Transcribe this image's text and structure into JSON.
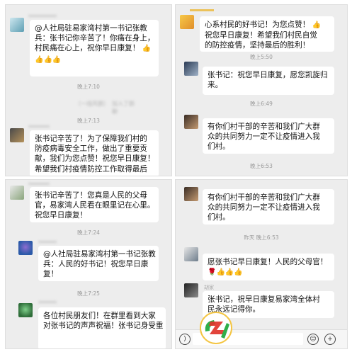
{
  "panel1": {
    "msg1": [
      "@人社局驻易家湾村第一书记张教",
      "兵：张书记你辛苦了！你痛在身上，",
      "村民痛在心上，祝你早日康复！"
    ],
    "time1": "晚上7:10",
    "ghost_text": "（一线风貌）",
    "ghost_join": "加入了群聊",
    "time2": "晚上7:13",
    "msg2": [
      "张书记辛苦了！为了保障我们村的",
      "防疫病毒安全工作，做出了重要贡",
      "献，我们为您点赞！祝您早日康复！",
      "希望我们村疫情防控工作取得最后"
    ]
  },
  "panel2": {
    "msg1": [
      "心系村民的好书记！为您点赞！",
      "祝您早日康复！希望我们村民自觉",
      "的防控疫情，坚持最后的胜利！"
    ],
    "time1": "晚上5:50",
    "msg2": [
      "张书记：祝您早日康复，愿您凯旋归",
      "来。"
    ],
    "time2": "晚上6:49",
    "msg3": [
      "有你们村干部的辛苦和我们广大群",
      "众的共同努力一定不让疫情进入我",
      "们村。"
    ],
    "time3": "晚上6:53"
  },
  "panel3": {
    "msg1": [
      "张书记辛苦了！您真是人民的父母",
      "官，易家湾人民看在眼里记在心里。",
      "祝您早日康复！"
    ],
    "time1": "晚上7:24",
    "msg2": [
      "@人社局驻易家湾村第一书记张教",
      "兵：人民的好书记！祝您早日康",
      "复！"
    ],
    "time2": "晚上7:25",
    "msg3": [
      "各位村民朋友们！在群里看到大家",
      "对张书记的声声祝福！张书记身受重"
    ]
  },
  "panel4": {
    "msg1": [
      "有你们村干部的辛苦和我们广大群",
      "众的共同努力一定不让疫情进入我",
      "们村。"
    ],
    "time1": "晚上6:53",
    "time1_prefix": "昨天",
    "msg2": [
      "愿张书记早日康复！人民的父母官！"
    ],
    "sender3": "胡家",
    "msg3": [
      "张书记，祝早日康复易家湾全体村",
      "民永远记得你。"
    ]
  },
  "colors": {
    "panel_bg": "#ededed",
    "bubble": "#ffffff",
    "time": "#9a9a9a",
    "emoji": "#e3a21a",
    "logo_green": "#2fae4a",
    "logo_red": "#e0342b"
  },
  "icons": {
    "voice": "voice-icon",
    "emoji": "emoji-icon",
    "plus": "plus-icon",
    "thumb": "thumbs-up-emoji"
  }
}
